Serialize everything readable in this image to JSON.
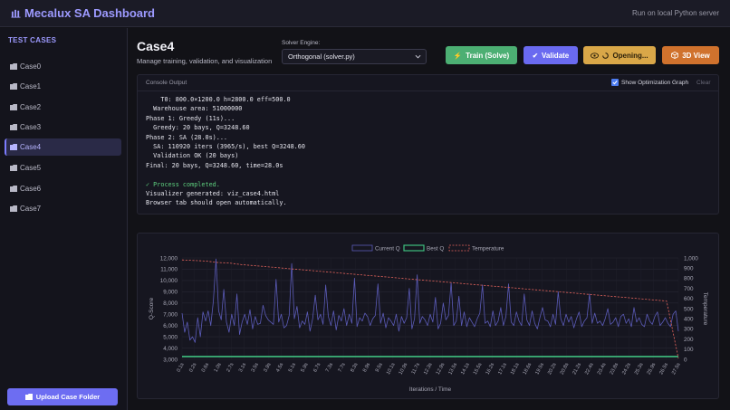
{
  "header": {
    "title": "Mecalux SA Dashboard",
    "server_note": "Run on local Python server"
  },
  "sidebar": {
    "heading": "TEST CASES",
    "items": [
      {
        "label": "Case0",
        "active": false
      },
      {
        "label": "Case1",
        "active": false
      },
      {
        "label": "Case2",
        "active": false
      },
      {
        "label": "Case3",
        "active": false
      },
      {
        "label": "Case4",
        "active": true
      },
      {
        "label": "Case5",
        "active": false
      },
      {
        "label": "Case6",
        "active": false
      },
      {
        "label": "Case7",
        "active": false
      }
    ],
    "upload_label": "Upload Case Folder"
  },
  "main": {
    "title": "Case4",
    "subtitle": "Manage training, validation, and visualization"
  },
  "engine": {
    "label": "Solver Engine:",
    "selected": "Orthogonal (solver.py)"
  },
  "actions": {
    "train": "Train (Solve)",
    "validate": "Validate",
    "opening": "Opening...",
    "view3d": "3D View"
  },
  "console": {
    "label": "Console Output",
    "graph_toggle_label": "Show Optimization Graph",
    "graph_toggle_checked": true,
    "clear_label": "Clear",
    "lines": [
      {
        "text": "    T0: 800.0×1200.0 h=2800.0 eff=500.0",
        "kind": "normal"
      },
      {
        "text": "  Warehouse area: 51000000",
        "kind": "normal"
      },
      {
        "text": "Phase 1: Greedy (11s)...",
        "kind": "normal"
      },
      {
        "text": "  Greedy: 20 bays, Q=3248.60",
        "kind": "normal"
      },
      {
        "text": "Phase 2: SA (28.0s)...",
        "kind": "normal"
      },
      {
        "text": "  SA: 110920 iters (3965/s), best Q=3248.60",
        "kind": "normal"
      },
      {
        "text": "  Validation OK (20 bays)",
        "kind": "normal"
      },
      {
        "text": "Final: 20 bays, Q=3248.60, time=28.0s",
        "kind": "normal"
      },
      {
        "text": "",
        "kind": "normal"
      },
      {
        "text": "✓ Process completed.",
        "kind": "ok"
      },
      {
        "text": "Visualizer generated: viz_case4.html",
        "kind": "normal"
      },
      {
        "text": "Browser tab should open automatically.",
        "kind": "normal"
      }
    ]
  },
  "colors": {
    "accent": "#9d9aff",
    "train": "#4caf73",
    "validate": "#6a6af0",
    "opening": "#d9a748",
    "view3d": "#d0722d",
    "current_q": "#5b5bb8",
    "best_q": "#3fbf7f",
    "temperature": "#e0625b"
  },
  "chart_data": {
    "type": "line",
    "xlabel": "Iterations / Time",
    "ylabel": "Q-Score",
    "y2label": "Temperature",
    "ylim": [
      3000,
      12000
    ],
    "y2lim": [
      0,
      1000
    ],
    "yticks": [
      "3,000",
      "4,000",
      "5,000",
      "6,000",
      "7,000",
      "8,000",
      "9,000",
      "10,000",
      "11,000",
      "12,000"
    ],
    "y2ticks": [
      "0",
      "100",
      "200",
      "300",
      "400",
      "500",
      "600",
      "700",
      "800",
      "900",
      "1,000"
    ],
    "xticks": [
      "0.1s",
      "0.2s",
      "0.6s",
      "1.0s",
      "2.7s",
      "3.1s",
      "3.5s",
      "3.9s",
      "4.5s",
      "5.1s",
      "5.9s",
      "6.7s",
      "7.3s",
      "7.7s",
      "8.3s",
      "8.9s",
      "9.5s",
      "10.1s",
      "10.9s",
      "11.7s",
      "12.3s",
      "12.9s",
      "13.5s",
      "14.1s",
      "15.5s",
      "16.2s",
      "17.1s",
      "18.1s",
      "18.6s",
      "19.5s",
      "20.2s",
      "20.8s",
      "21.2s",
      "22.4s",
      "23.4s",
      "23.8s",
      "24.2s",
      "25.3s",
      "25.9s",
      "26.5s",
      "27.5s"
    ],
    "legend_position": "top",
    "grid": true,
    "series": [
      {
        "name": "Current Q",
        "style": "solid",
        "values": [
          7100,
          5400,
          6300,
          4700,
          5000,
          4500,
          6700,
          5000,
          7200,
          6400,
          7300,
          6000,
          8200,
          11900,
          7300,
          6500,
          9200,
          6300,
          5400,
          7000,
          6000,
          8800,
          5200,
          6300,
          7000,
          6100,
          7400,
          5700,
          6800,
          6100,
          6200,
          7800,
          6900,
          6500,
          6300,
          6100,
          10100,
          6300,
          7000,
          5800,
          6000,
          6900,
          11500,
          6600,
          7700,
          5800,
          6400,
          6100,
          7200,
          5500,
          6600,
          8700,
          6500,
          7000,
          6100,
          9600,
          6800,
          6000,
          7300,
          5600,
          6900,
          6400,
          7500,
          6000,
          7000,
          6200,
          10200,
          5900,
          6700,
          6400,
          7100,
          6800,
          6000,
          6600,
          6900,
          9700,
          6200,
          7100,
          5800,
          6700,
          6400,
          6000,
          7000,
          5500,
          6800,
          6200,
          6700,
          9300,
          5700,
          6600,
          10500,
          6200,
          6800,
          6500,
          6000,
          7000,
          6300,
          8500,
          5700,
          6200,
          8000,
          6500,
          6900,
          9800,
          6000,
          6400,
          8600,
          6000,
          7200,
          5900,
          6700,
          6300,
          5900,
          6600,
          7100,
          9600,
          6200,
          6400,
          5900,
          7300,
          6000,
          6400,
          7600,
          6000,
          6800,
          9700,
          6300,
          6000,
          7200,
          6400,
          6000,
          8800,
          6500,
          6000,
          7300,
          6200,
          5700,
          6700,
          7600,
          6500,
          6400,
          5900,
          7000,
          6100,
          9000,
          6600,
          6000,
          7000,
          6300,
          6800,
          5800,
          6600,
          7200,
          5900,
          6400,
          6700,
          8800,
          6200,
          7100,
          6200,
          6400,
          6000,
          6600,
          7500,
          6100,
          6300,
          6700,
          5900,
          6800,
          7000,
          6200,
          6600,
          5900,
          7600,
          6300,
          6700,
          6100,
          5900,
          7000,
          6400,
          6100,
          6800,
          7200,
          6000,
          6300,
          6700,
          6200,
          5900,
          7000,
          7300,
          5500
        ]
      },
      {
        "name": "Best Q",
        "style": "solid",
        "values": [
          3249,
          3249,
          3249,
          3249,
          3249,
          3249,
          3249,
          3249,
          3249,
          3249,
          3249,
          3249,
          3249,
          3249,
          3249,
          3249,
          3249,
          3249,
          3249,
          3249,
          3249,
          3249,
          3249,
          3249,
          3249,
          3249,
          3249,
          3249,
          3249,
          3249,
          3249,
          3249,
          3249,
          3249,
          3249,
          3249,
          3249,
          3249,
          3249,
          3249,
          3249
        ]
      },
      {
        "name": "Temperature",
        "style": "dashed",
        "axis": "right",
        "values": [
          980,
          975,
          970,
          955,
          950,
          935,
          925,
          915,
          905,
          895,
          885,
          875,
          865,
          855,
          845,
          835,
          825,
          815,
          805,
          795,
          785,
          775,
          765,
          755,
          745,
          735,
          725,
          715,
          705,
          695,
          685,
          675,
          665,
          655,
          645,
          635,
          625,
          615,
          605,
          595,
          585,
          575,
          10
        ]
      }
    ]
  }
}
